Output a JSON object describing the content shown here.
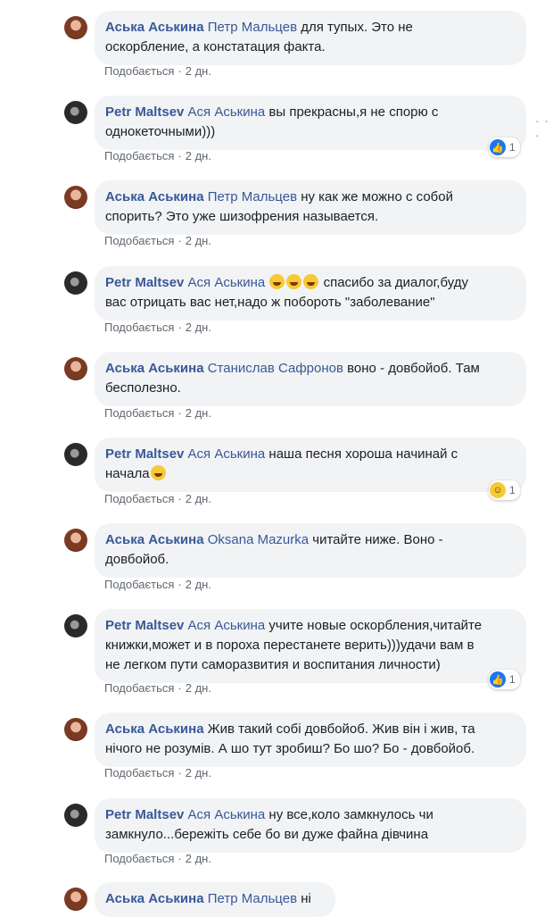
{
  "comments": [
    {
      "author": "Аська Аськина",
      "mention": "Петр Мальцев",
      "text_lines": [
        "для тупых. Это не",
        "оскорбление, а констатация факта."
      ],
      "like": "Подобається",
      "time": "2 дн.",
      "reaction": null
    },
    {
      "author": "Petr Maltsev",
      "mention": "Ася Аськина",
      "text_lines": [
        "вы прекрасны,я не спорю с",
        "однокеточными)))"
      ],
      "like": "Подобається",
      "time": "2 дн.",
      "reaction": {
        "icon": "like",
        "count": "1"
      }
    },
    {
      "author": "Аська Аськина",
      "mention": "Петр Мальцев",
      "text_lines": [
        "ну как же можно с собой",
        "спорить? Это уже шизофрения называется."
      ],
      "like": "Подобається",
      "time": "2 дн.",
      "reaction": null
    },
    {
      "author": "Petr Maltsev",
      "mention": "Ася Аськина",
      "text_lines": [
        "спасибо за диалог,буду",
        "вас отрицать вас нет,надо ж побороть \"заболевание\""
      ],
      "like": "Подобається",
      "time": "2 дн.",
      "reaction": null
    },
    {
      "author": "Аська Аськина",
      "mention": "Станислав Сафронов",
      "text_lines": [
        "воно - довбойоб. Там",
        "бесполезно."
      ],
      "like": "Подобається",
      "time": "2 дн.",
      "reaction": null
    },
    {
      "author": "Petr Maltsev",
      "mention": "Ася Аськина",
      "text_lines": [
        "наша песня хороша начинай с",
        "начала"
      ],
      "like": "Подобається",
      "time": "2 дн.",
      "reaction": {
        "icon": "laugh",
        "count": "1"
      }
    },
    {
      "author": "Аська Аськина",
      "mention": "Oksana Mazurka",
      "text_lines": [
        "читайте ниже. Воно -",
        "довбойоб."
      ],
      "like": "Подобається",
      "time": "2 дн.",
      "reaction": null
    },
    {
      "author": "Petr Maltsev",
      "mention": "Ася Аськина",
      "text_lines": [
        "учите новые оскорбления,читайте",
        "книжки,может и в пороха перестанете верить)))удачи вам в",
        "не легком пути саморазвития и воспитания личности)"
      ],
      "like": "Подобається",
      "time": "2 дн.",
      "reaction": {
        "icon": "like",
        "count": "1"
      }
    },
    {
      "author": "Аська Аськина",
      "mention": "",
      "text_lines": [
        "Жив такий собі довбойоб. Жив він і жив, та",
        "нічого не розумів. А шо тут зробиш? Бо шо? Бо - довбойоб."
      ],
      "like": "Подобається",
      "time": "2 дн.",
      "reaction": null
    },
    {
      "author": "Petr Maltsev",
      "mention": "Ася Аськина",
      "text_lines": [
        "ну все,коло замкнулось чи",
        "замкнуло...бережіть себе бо ви дуже файна дівчина"
      ],
      "like": "Подобається",
      "time": "2 дн.",
      "reaction": null
    },
    {
      "author": "Аська Аськина",
      "mention": "Петр Мальцев",
      "text_lines": [
        "ні"
      ],
      "like": "",
      "time": "",
      "reaction": null
    }
  ],
  "options_icon": "more-dots-icon"
}
